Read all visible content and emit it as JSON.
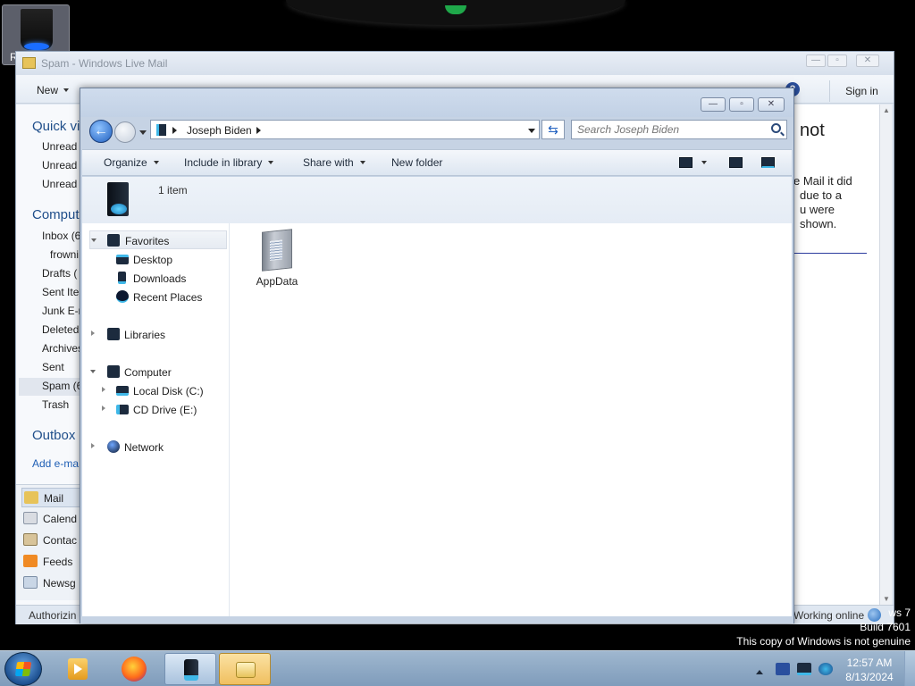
{
  "desktop": {
    "recycle_bin_label": "R"
  },
  "mail_window": {
    "title": "Spam - Windows Live Mail",
    "toolbar": {
      "new_label": "New",
      "help_label": "?",
      "sign_in_label": "Sign in"
    },
    "folders": {
      "quick_views_heading": "Quick vi",
      "quick_views": [
        "Unread",
        "Unread",
        "Unread"
      ],
      "computer_heading": "Comput",
      "items": [
        "Inbox (6",
        "frowni",
        "Drafts (",
        "Sent Iter",
        "Junk E-r",
        "Deleted",
        "Archives",
        "Sent",
        "Spam (6",
        "Trash"
      ],
      "outbox_heading": "Outbox",
      "add_email_account": "Add e-ma"
    },
    "nav": [
      "Mail",
      "Calend",
      "Contac",
      "Feeds",
      "Newsg"
    ],
    "reading_pane": {
      "heading_fragment": "not",
      "message_lines": [
        "e Mail it did",
        "due to a",
        "u were",
        "shown."
      ]
    },
    "status": {
      "left_text": "Authorizin",
      "right_text": "Working online"
    }
  },
  "explorer": {
    "address_crumb": "Joseph Biden",
    "search_placeholder": "Search Joseph Biden",
    "commands": {
      "organize": "Organize",
      "include_in_library": "Include in library",
      "share_with": "Share with",
      "new_folder": "New folder"
    },
    "item_count": "1 item",
    "nav_tree": {
      "favorites": "Favorites",
      "desktop": "Desktop",
      "downloads": "Downloads",
      "recent_places": "Recent Places",
      "libraries": "Libraries",
      "computer": "Computer",
      "local_disk": "Local Disk (C:)",
      "cd_drive": "CD Drive (E:)",
      "network": "Network"
    },
    "files": [
      {
        "name": "AppData"
      }
    ]
  },
  "watermark": {
    "line1": "ws 7",
    "line2": "Build 7601",
    "line3": "This copy of Windows is not genuine"
  },
  "taskbar": {
    "time": "12:57 AM",
    "date": "8/13/2024"
  }
}
